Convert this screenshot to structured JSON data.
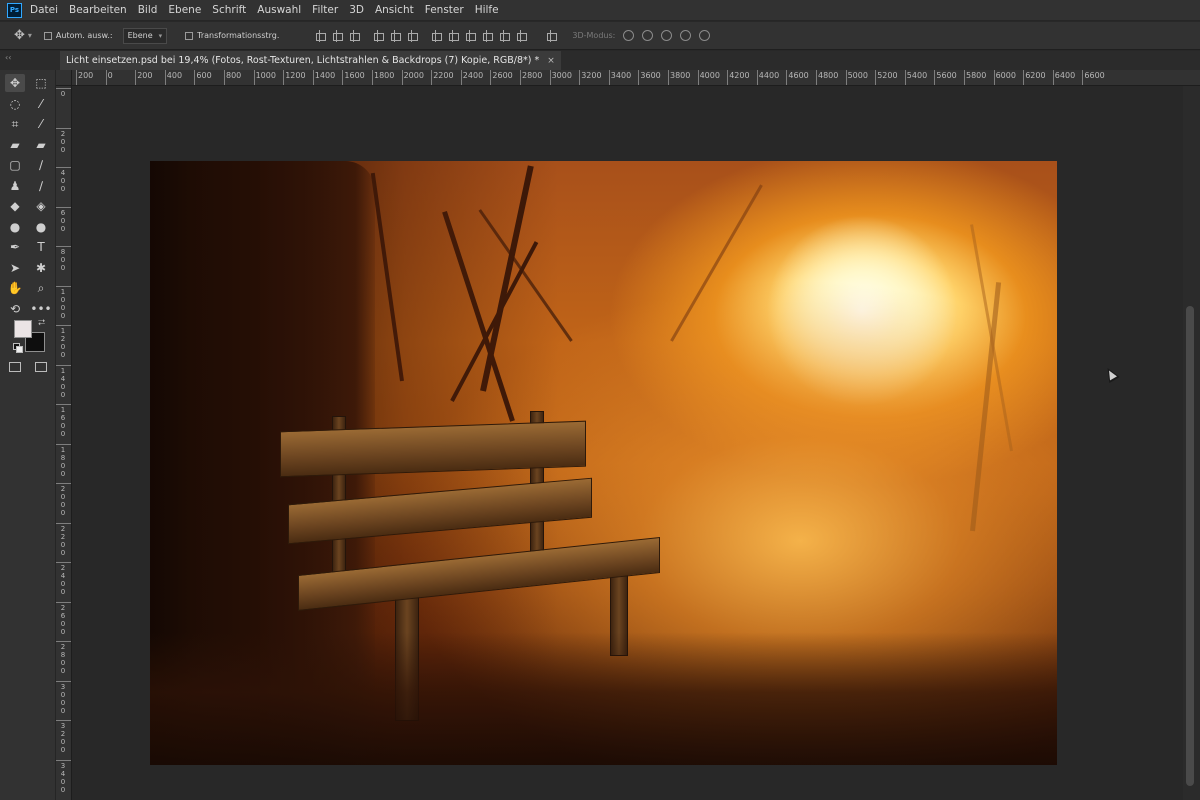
{
  "app": {
    "logo": "Ps",
    "menu": [
      "Datei",
      "Bearbeiten",
      "Bild",
      "Ebene",
      "Schrift",
      "Auswahl",
      "Filter",
      "3D",
      "Ansicht",
      "Fenster",
      "Hilfe"
    ]
  },
  "options": {
    "auto_select_label": "Autom. ausw.:",
    "layer_select_value": "Ebene",
    "transform_label": "Transformationsstrg.",
    "mode_3d_label": "3D-Modus:"
  },
  "document": {
    "tab_title": "Licht einsetzen.psd bei 19,4% (Fotos, Rost-Texturen, Lichtstrahlen & Backdrops (7) Kopie, RGB/8*) *",
    "close_glyph": "×",
    "panel_arrows": "‹‹"
  },
  "ruler_top": [
    "200",
    "0",
    "200",
    "400",
    "600",
    "800",
    "1000",
    "1200",
    "1400",
    "1600",
    "1800",
    "2000",
    "2200",
    "2400",
    "2600",
    "2800",
    "3000",
    "3200",
    "3400",
    "3600",
    "3800",
    "4000",
    "4200",
    "4400",
    "4600",
    "4800",
    "5000",
    "5200",
    "5400",
    "5600",
    "5800",
    "6000",
    "6200",
    "6400",
    "6600"
  ],
  "ruler_left": [
    "0",
    "2\n0\n0",
    "4\n0\n0",
    "6\n0\n0",
    "8\n0\n0",
    "1\n0\n0\n0",
    "1\n2\n0\n0",
    "1\n4\n0\n0",
    "1\n6\n0\n0",
    "1\n8\n0\n0",
    "2\n0\n0\n0",
    "2\n2\n0\n0",
    "2\n4\n0\n0",
    "2\n6\n0\n0",
    "2\n8\n0\n0",
    "3\n0\n0\n0",
    "3\n2\n0\n0",
    "3\n4\n0\n0"
  ],
  "tools": [
    [
      "move-tool",
      "marquee-tool"
    ],
    [
      "lasso-tool",
      "magic-wand-tool"
    ],
    [
      "crop-tool",
      "eyedropper-tool"
    ],
    [
      "healing-brush-tool",
      "patch-tool"
    ],
    [
      "frame-tool",
      "brush-tool"
    ],
    [
      "clone-stamp-tool",
      "history-brush-tool"
    ],
    [
      "eraser-tool",
      "paint-bucket-tool"
    ],
    [
      "blur-tool",
      "dodge-tool"
    ],
    [
      "pen-tool",
      "type-tool"
    ],
    [
      "path-selection-tool",
      "custom-shape-tool"
    ],
    [
      "hand-tool",
      "zoom-tool"
    ],
    [
      "rotate-view-tool",
      "more-tools"
    ]
  ],
  "tool_glyphs": {
    "move-tool": "✥",
    "marquee-tool": "⬚",
    "lasso-tool": "◌",
    "magic-wand-tool": "⁄",
    "crop-tool": "⌗",
    "eyedropper-tool": "⁄",
    "healing-brush-tool": "▰",
    "patch-tool": "▰",
    "frame-tool": "▢",
    "brush-tool": "∕",
    "clone-stamp-tool": "♟",
    "history-brush-tool": "∕",
    "eraser-tool": "◆",
    "paint-bucket-tool": "◈",
    "blur-tool": "●",
    "dodge-tool": "●",
    "pen-tool": "✒",
    "type-tool": "T",
    "path-selection-tool": "➤",
    "custom-shape-tool": "✱",
    "hand-tool": "✋",
    "zoom-tool": "⌕",
    "rotate-view-tool": "⟲",
    "more-tools": "•••"
  },
  "colors": {
    "foreground": "#ebe4e5",
    "background": "#0e0e0e",
    "accent": "#31a8ff"
  }
}
